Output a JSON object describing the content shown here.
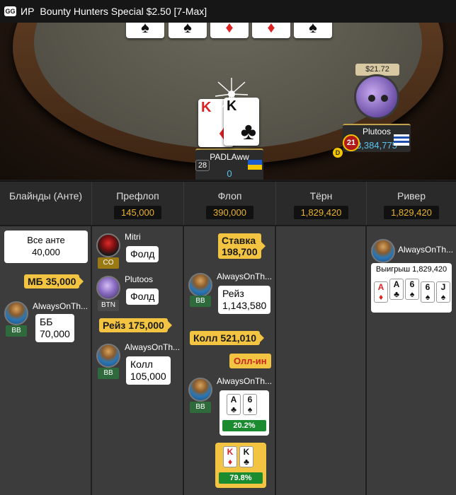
{
  "title": {
    "logo": "GG",
    "mode": "ИР",
    "table_name": "Bounty Hunters Special $2.50 [7-Max]"
  },
  "board": [
    {
      "suit": "♠",
      "color": "black"
    },
    {
      "suit": "♠",
      "color": "black"
    },
    {
      "suit": "♦",
      "color": "red"
    },
    {
      "suit": "♦",
      "color": "red"
    },
    {
      "suit": "♠",
      "color": "black"
    }
  ],
  "hero": {
    "name": "PADLAww",
    "stack": "0",
    "bounty": "28",
    "cards": [
      {
        "rank": "K",
        "suit": "♦",
        "color": "red"
      },
      {
        "rank": "K",
        "suit": "♣",
        "color": "black"
      }
    ]
  },
  "villain": {
    "name": "Plutoos",
    "stack": "3,384,775",
    "stack_tag": "$21.72",
    "bounty": "21",
    "dealer": "D"
  },
  "streets": [
    {
      "label": "Блайнды (Анте)",
      "pot": ""
    },
    {
      "label": "Префлоп",
      "pot": "145,000"
    },
    {
      "label": "Флоп",
      "pot": "390,000"
    },
    {
      "label": "Тёрн",
      "pot": "1,829,420"
    },
    {
      "label": "Ривер",
      "pot": "1,829,420"
    }
  ],
  "blinds": {
    "all_ante_label": "Все анте",
    "all_ante_value": "40,000",
    "sb_pill": "МБ 35,000",
    "player_name": "AlwaysOnTh...",
    "position": "BB",
    "bb_action": "ББ",
    "bb_amount": "70,000"
  },
  "preflop": {
    "mitri": {
      "name": "Mitri",
      "position": "CO",
      "action": "Фолд"
    },
    "plutoos": {
      "name": "Plutoos",
      "position": "BTN",
      "action": "Фолд",
      "raise_pill": "Рейз 175,000"
    },
    "always": {
      "name": "AlwaysOnTh...",
      "position": "BB",
      "action": "Колл",
      "amount": "105,000"
    }
  },
  "flop": {
    "bet_pill_label": "Ставка",
    "bet_pill_amount": "198,700",
    "always_raise": {
      "name": "AlwaysOnTh...",
      "position": "BB",
      "action": "Рейз",
      "amount": "1,143,580"
    },
    "call_pill": "Колл 521,010",
    "allin_pill": "Олл-ин",
    "showdown_always": {
      "name": "AlwaysOnTh...",
      "position": "BB",
      "cards": [
        {
          "rank": "A",
          "suit": "♣",
          "color": "black"
        },
        {
          "rank": "6",
          "suit": "♠",
          "color": "black"
        }
      ],
      "equity": "20.2%"
    },
    "showdown_hero": {
      "cards": [
        {
          "rank": "K",
          "suit": "♦",
          "color": "red"
        },
        {
          "rank": "K",
          "suit": "♣",
          "color": "black"
        }
      ],
      "equity": "79.8%"
    }
  },
  "river": {
    "winner_name": "AlwaysOnTh...",
    "win_label": "Выигрыш 1,829,420",
    "cards": [
      {
        "rank": "A",
        "suit": "♦",
        "color": "red"
      },
      {
        "rank": "A",
        "suit": "♣",
        "color": "black"
      },
      {
        "rank": "6",
        "suit": "♠",
        "color": "black"
      },
      {
        "rank": "6",
        "suit": "♠",
        "color": "black"
      },
      {
        "rank": "J",
        "suit": "♠",
        "color": "black"
      }
    ]
  },
  "colors": {
    "accent_yellow": "#f3c441",
    "pot_gold": "#e8b32c",
    "stack_blue": "#5cc4ef",
    "equity_green": "#1a8c2f",
    "allin_red": "#c4271e"
  }
}
